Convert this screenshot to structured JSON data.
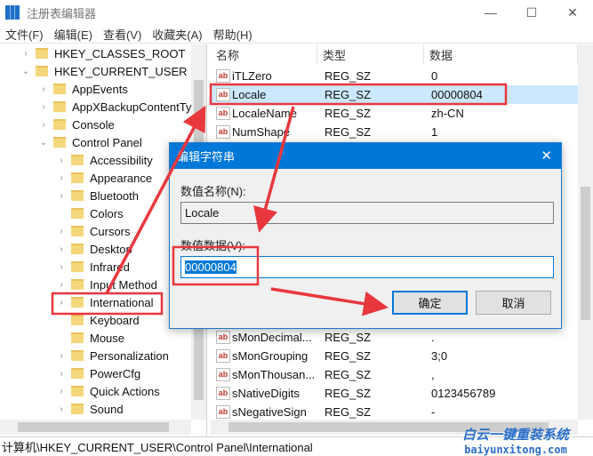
{
  "window": {
    "title": "注册表编辑器",
    "minimize": "—",
    "maximize": "☐",
    "close": "✕"
  },
  "menu": [
    "文件(F)",
    "编辑(E)",
    "查看(V)",
    "收藏夹(A)",
    "帮助(H)"
  ],
  "tree": [
    {
      "label": "HKEY_CLASSES_ROOT",
      "level": 0,
      "exp": "›"
    },
    {
      "label": "HKEY_CURRENT_USER",
      "level": 0,
      "exp": "⌄"
    },
    {
      "label": "AppEvents",
      "level": 1,
      "exp": "›"
    },
    {
      "label": "AppXBackupContentTy",
      "level": 1,
      "exp": "›"
    },
    {
      "label": "Console",
      "level": 1,
      "exp": "›"
    },
    {
      "label": "Control Panel",
      "level": 1,
      "exp": "⌄"
    },
    {
      "label": "Accessibility",
      "level": 2,
      "exp": "›"
    },
    {
      "label": "Appearance",
      "level": 2,
      "exp": "›"
    },
    {
      "label": "Bluetooth",
      "level": 2,
      "exp": "›"
    },
    {
      "label": "Colors",
      "level": 2,
      "exp": ""
    },
    {
      "label": "Cursors",
      "level": 2,
      "exp": "›"
    },
    {
      "label": "Desktop",
      "level": 2,
      "exp": "›"
    },
    {
      "label": "Infrared",
      "level": 2,
      "exp": "›"
    },
    {
      "label": "Input Method",
      "level": 2,
      "exp": "›"
    },
    {
      "label": "International",
      "level": 2,
      "exp": "›",
      "selected": true
    },
    {
      "label": "Keyboard",
      "level": 2,
      "exp": ""
    },
    {
      "label": "Mouse",
      "level": 2,
      "exp": ""
    },
    {
      "label": "Personalization",
      "level": 2,
      "exp": "›"
    },
    {
      "label": "PowerCfg",
      "level": 2,
      "exp": "›"
    },
    {
      "label": "Quick Actions",
      "level": 2,
      "exp": "›"
    },
    {
      "label": "Sound",
      "level": 2,
      "exp": "›"
    }
  ],
  "list": {
    "headers": [
      "名称",
      "类型",
      "数据"
    ],
    "top_rows": [
      {
        "name": "iTLZero",
        "type": "REG_SZ",
        "data": "0"
      },
      {
        "name": "Locale",
        "type": "REG_SZ",
        "data": "00000804",
        "selected": true
      },
      {
        "name": "LocaleName",
        "type": "REG_SZ",
        "data": "zh-CN"
      },
      {
        "name": "NumShape",
        "type": "REG_SZ",
        "data": "1"
      }
    ],
    "bottom_rows": [
      {
        "name": "sMonDecimal...",
        "type": "REG_SZ",
        "data": "."
      },
      {
        "name": "sMonGrouping",
        "type": "REG_SZ",
        "data": "3;0"
      },
      {
        "name": "sMonThousan...",
        "type": "REG_SZ",
        "data": ","
      },
      {
        "name": "sNativeDigits",
        "type": "REG_SZ",
        "data": "0123456789"
      },
      {
        "name": "sNegativeSign",
        "type": "REG_SZ",
        "data": "-"
      }
    ],
    "icon_text": "ab"
  },
  "dialog": {
    "title": "编辑字符串",
    "name_label": "数值名称(N):",
    "name_value": "Locale",
    "data_label": "数值数据(V):",
    "data_value": "00000804",
    "ok": "确定",
    "cancel": "取消",
    "close": "✕"
  },
  "status": "计算机\\HKEY_CURRENT_USER\\Control Panel\\International",
  "watermark": {
    "line1": "白云一键重装系统",
    "line2": "baiyunxitong.com"
  },
  "colors": {
    "accent": "#0078d7",
    "annotation": "#e8383d",
    "selection": "#cce8ff"
  }
}
